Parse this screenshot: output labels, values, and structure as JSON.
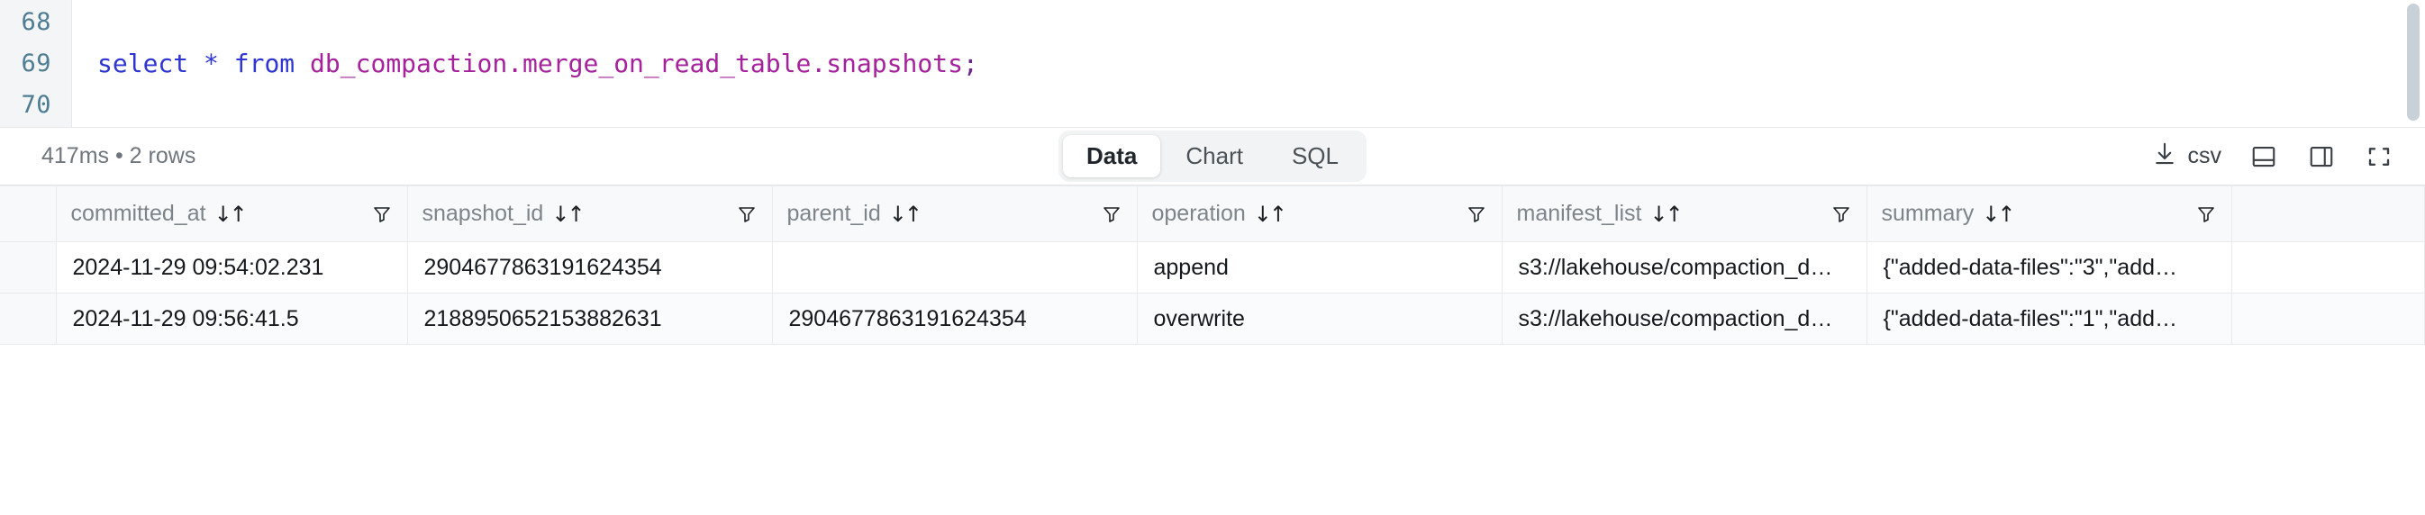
{
  "editor": {
    "line_numbers": [
      "68",
      "69",
      "70"
    ],
    "sql_tokens": [
      {
        "text": "select",
        "type": "keyword"
      },
      {
        "text": " ",
        "type": "plain"
      },
      {
        "text": "*",
        "type": "operator"
      },
      {
        "text": " ",
        "type": "plain"
      },
      {
        "text": "from",
        "type": "keyword"
      },
      {
        "text": " ",
        "type": "plain"
      },
      {
        "text": "db_compaction",
        "type": "identifier"
      },
      {
        "text": ".",
        "type": "identifier"
      },
      {
        "text": "merge_on_read_table",
        "type": "identifier"
      },
      {
        "text": ".",
        "type": "identifier"
      },
      {
        "text": "snapshots",
        "type": "identifier"
      },
      {
        "text": ";",
        "type": "punctuation"
      }
    ],
    "sql_text": "select * from db_compaction.merge_on_read_table.snapshots;",
    "scrollbar": "vertical-scrollbar"
  },
  "toolbar": {
    "status": "417ms  •  2 rows",
    "duration": "417ms",
    "row_count": "2 rows",
    "tabs": [
      {
        "label": "Data",
        "active": true
      },
      {
        "label": "Chart",
        "active": false
      },
      {
        "label": "SQL",
        "active": false
      }
    ],
    "export": {
      "icon": "download-icon",
      "label": "csv"
    },
    "layout_buttons": [
      {
        "name": "split-horizontal-icon"
      },
      {
        "name": "split-vertical-icon"
      },
      {
        "name": "fullscreen-icon"
      }
    ]
  },
  "table": {
    "columns": [
      {
        "name": "committed_at",
        "sort": "↓↑",
        "filter": "filter-icon"
      },
      {
        "name": "snapshot_id",
        "sort": "↓↑",
        "filter": "filter-icon"
      },
      {
        "name": "parent_id",
        "sort": "↓↑",
        "filter": "filter-icon"
      },
      {
        "name": "operation",
        "sort": "↓↑",
        "filter": "filter-icon"
      },
      {
        "name": "manifest_list",
        "sort": "↓↑",
        "filter": "filter-icon"
      },
      {
        "name": "summary",
        "sort": "↓↑",
        "filter": "filter-icon"
      }
    ],
    "rows": [
      {
        "committed_at": "2024-11-29 09:54:02.231",
        "snapshot_id": "2904677863191624354",
        "parent_id": "",
        "operation": "append",
        "manifest_list": "s3://lakehouse/compaction_d…",
        "summary": "{\"added-data-files\":\"3\",\"add…"
      },
      {
        "committed_at": "2024-11-29 09:56:41.5",
        "snapshot_id": "2188950652153882631",
        "parent_id": "2904677863191624354",
        "operation": "overwrite",
        "manifest_list": "s3://lakehouse/compaction_d…",
        "summary": "{\"added-data-files\":\"1\",\"add…"
      }
    ]
  },
  "colors": {
    "keyword": "#2e35d2",
    "identifier": "#a6219c",
    "gutter_number": "#4d7c93",
    "header_bg": "#f8f9fa",
    "muted_text": "#7d848a"
  }
}
